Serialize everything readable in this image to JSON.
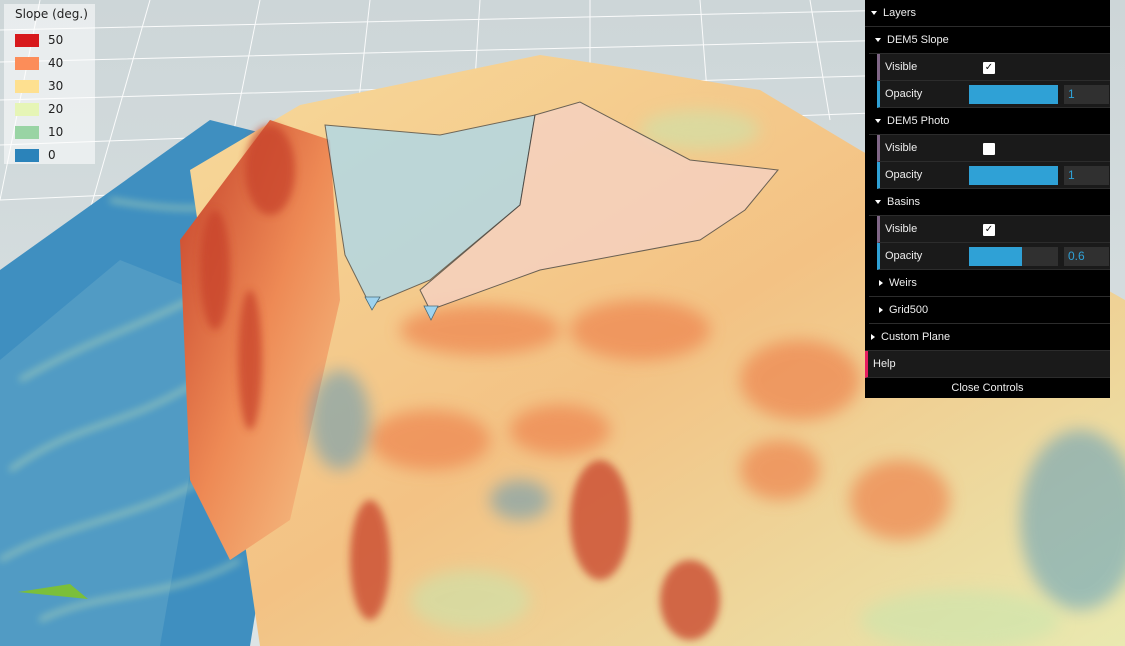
{
  "legend": {
    "title": "Slope (deg.)",
    "items": [
      {
        "label": "50",
        "color": "#d7191c"
      },
      {
        "label": "40",
        "color": "#fc8d59"
      },
      {
        "label": "30",
        "color": "#fee090"
      },
      {
        "label": "20",
        "color": "#e6f5b6"
      },
      {
        "label": "10",
        "color": "#99d4a4"
      },
      {
        "label": "0",
        "color": "#2b83ba"
      }
    ]
  },
  "gui": {
    "layers_title": "Layers",
    "dem5_slope": {
      "title": "DEM5 Slope",
      "visible_label": "Visible",
      "visible": true,
      "opacity_label": "Opacity",
      "opacity": "1",
      "opacity_fraction": 1.0
    },
    "dem5_photo": {
      "title": "DEM5 Photo",
      "visible_label": "Visible",
      "visible": false,
      "opacity_label": "Opacity",
      "opacity": "1",
      "opacity_fraction": 1.0
    },
    "basins": {
      "title": "Basins",
      "visible_label": "Visible",
      "visible": true,
      "opacity_label": "Opacity",
      "opacity": "0.6",
      "opacity_fraction": 0.6
    },
    "weirs_title": "Weirs",
    "grid500_title": "Grid500",
    "custom_plane_title": "Custom Plane",
    "help_title": "Help",
    "close_label": "Close Controls"
  },
  "icons": {
    "check": "✓",
    "compass": "north-arrow-icon"
  }
}
